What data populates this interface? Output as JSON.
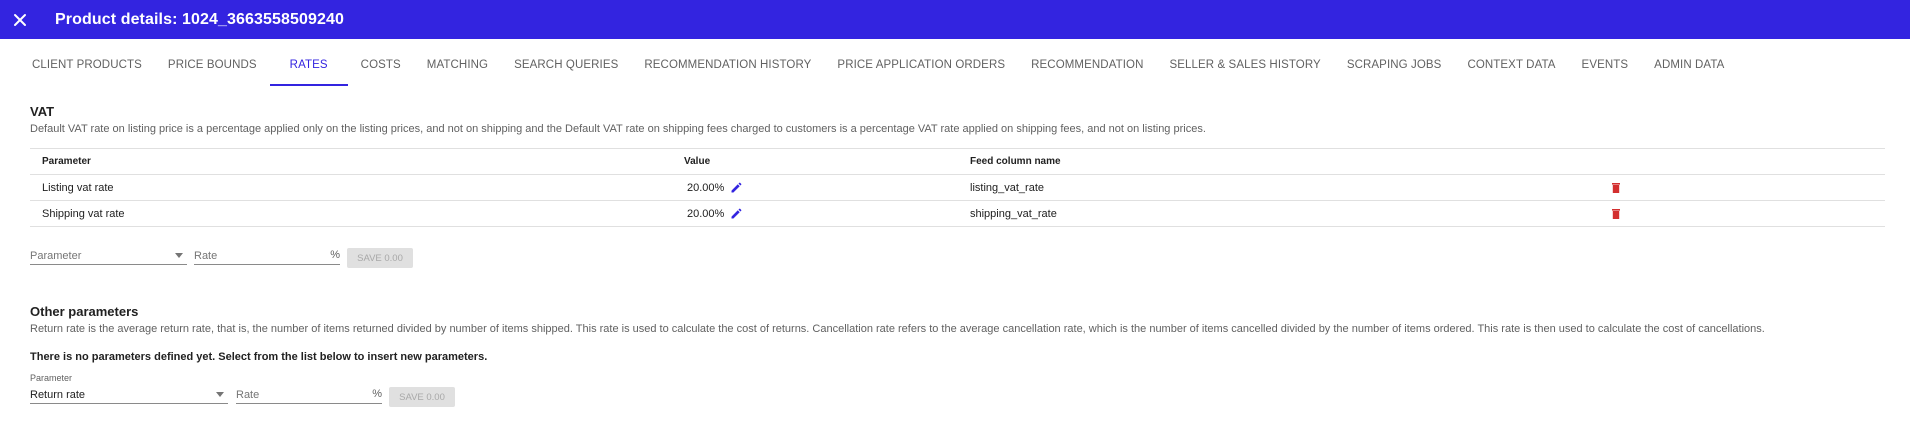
{
  "header": {
    "title": "Product details: 1024_3663558509240"
  },
  "tabs": [
    {
      "label": "CLIENT PRODUCTS"
    },
    {
      "label": "PRICE BOUNDS"
    },
    {
      "label": "RATES"
    },
    {
      "label": "COSTS"
    },
    {
      "label": "MATCHING"
    },
    {
      "label": "SEARCH QUERIES"
    },
    {
      "label": "RECOMMENDATION HISTORY"
    },
    {
      "label": "PRICE APPLICATION ORDERS"
    },
    {
      "label": "RECOMMENDATION"
    },
    {
      "label": "SELLER & SALES HISTORY"
    },
    {
      "label": "SCRAPING JOBS"
    },
    {
      "label": "CONTEXT DATA"
    },
    {
      "label": "EVENTS"
    },
    {
      "label": "ADMIN DATA"
    }
  ],
  "active_tab": "RATES",
  "vat": {
    "title": "VAT",
    "description": "Default VAT rate on listing price is a percentage applied only on the listing prices, and not on shipping and the Default VAT rate on shipping fees charged to customers is a percentage VAT rate applied on shipping fees, and not on listing prices.",
    "columns": {
      "parameter": "Parameter",
      "value": "Value",
      "feed": "Feed column name"
    },
    "rows": [
      {
        "parameter": "Listing vat rate",
        "value": "20.00%",
        "feed": "listing_vat_rate"
      },
      {
        "parameter": "Shipping vat rate",
        "value": "20.00%",
        "feed": "shipping_vat_rate"
      }
    ],
    "form": {
      "parameter_placeholder": "Parameter",
      "rate_placeholder": "Rate",
      "rate_suffix": "%",
      "save_label": "SAVE 0.00"
    }
  },
  "other": {
    "title": "Other parameters",
    "description": "Return rate is the average return rate, that is, the number of items returned divided by number of items shipped. This rate is used to calculate the cost of returns. Cancellation rate refers to the average cancellation rate, which is the number of items cancelled divided by the number of items ordered. This rate is then used to calculate the cost of cancellations.",
    "notice": "There is no parameters defined yet. Select from the list below to insert new parameters.",
    "form": {
      "parameter_label": "Parameter",
      "parameter_value": "Return rate",
      "rate_placeholder": "Rate",
      "rate_suffix": "%",
      "save_label": "SAVE 0.00"
    }
  },
  "colors": {
    "primary": "#3324e0",
    "delete": "#d32f2f"
  }
}
